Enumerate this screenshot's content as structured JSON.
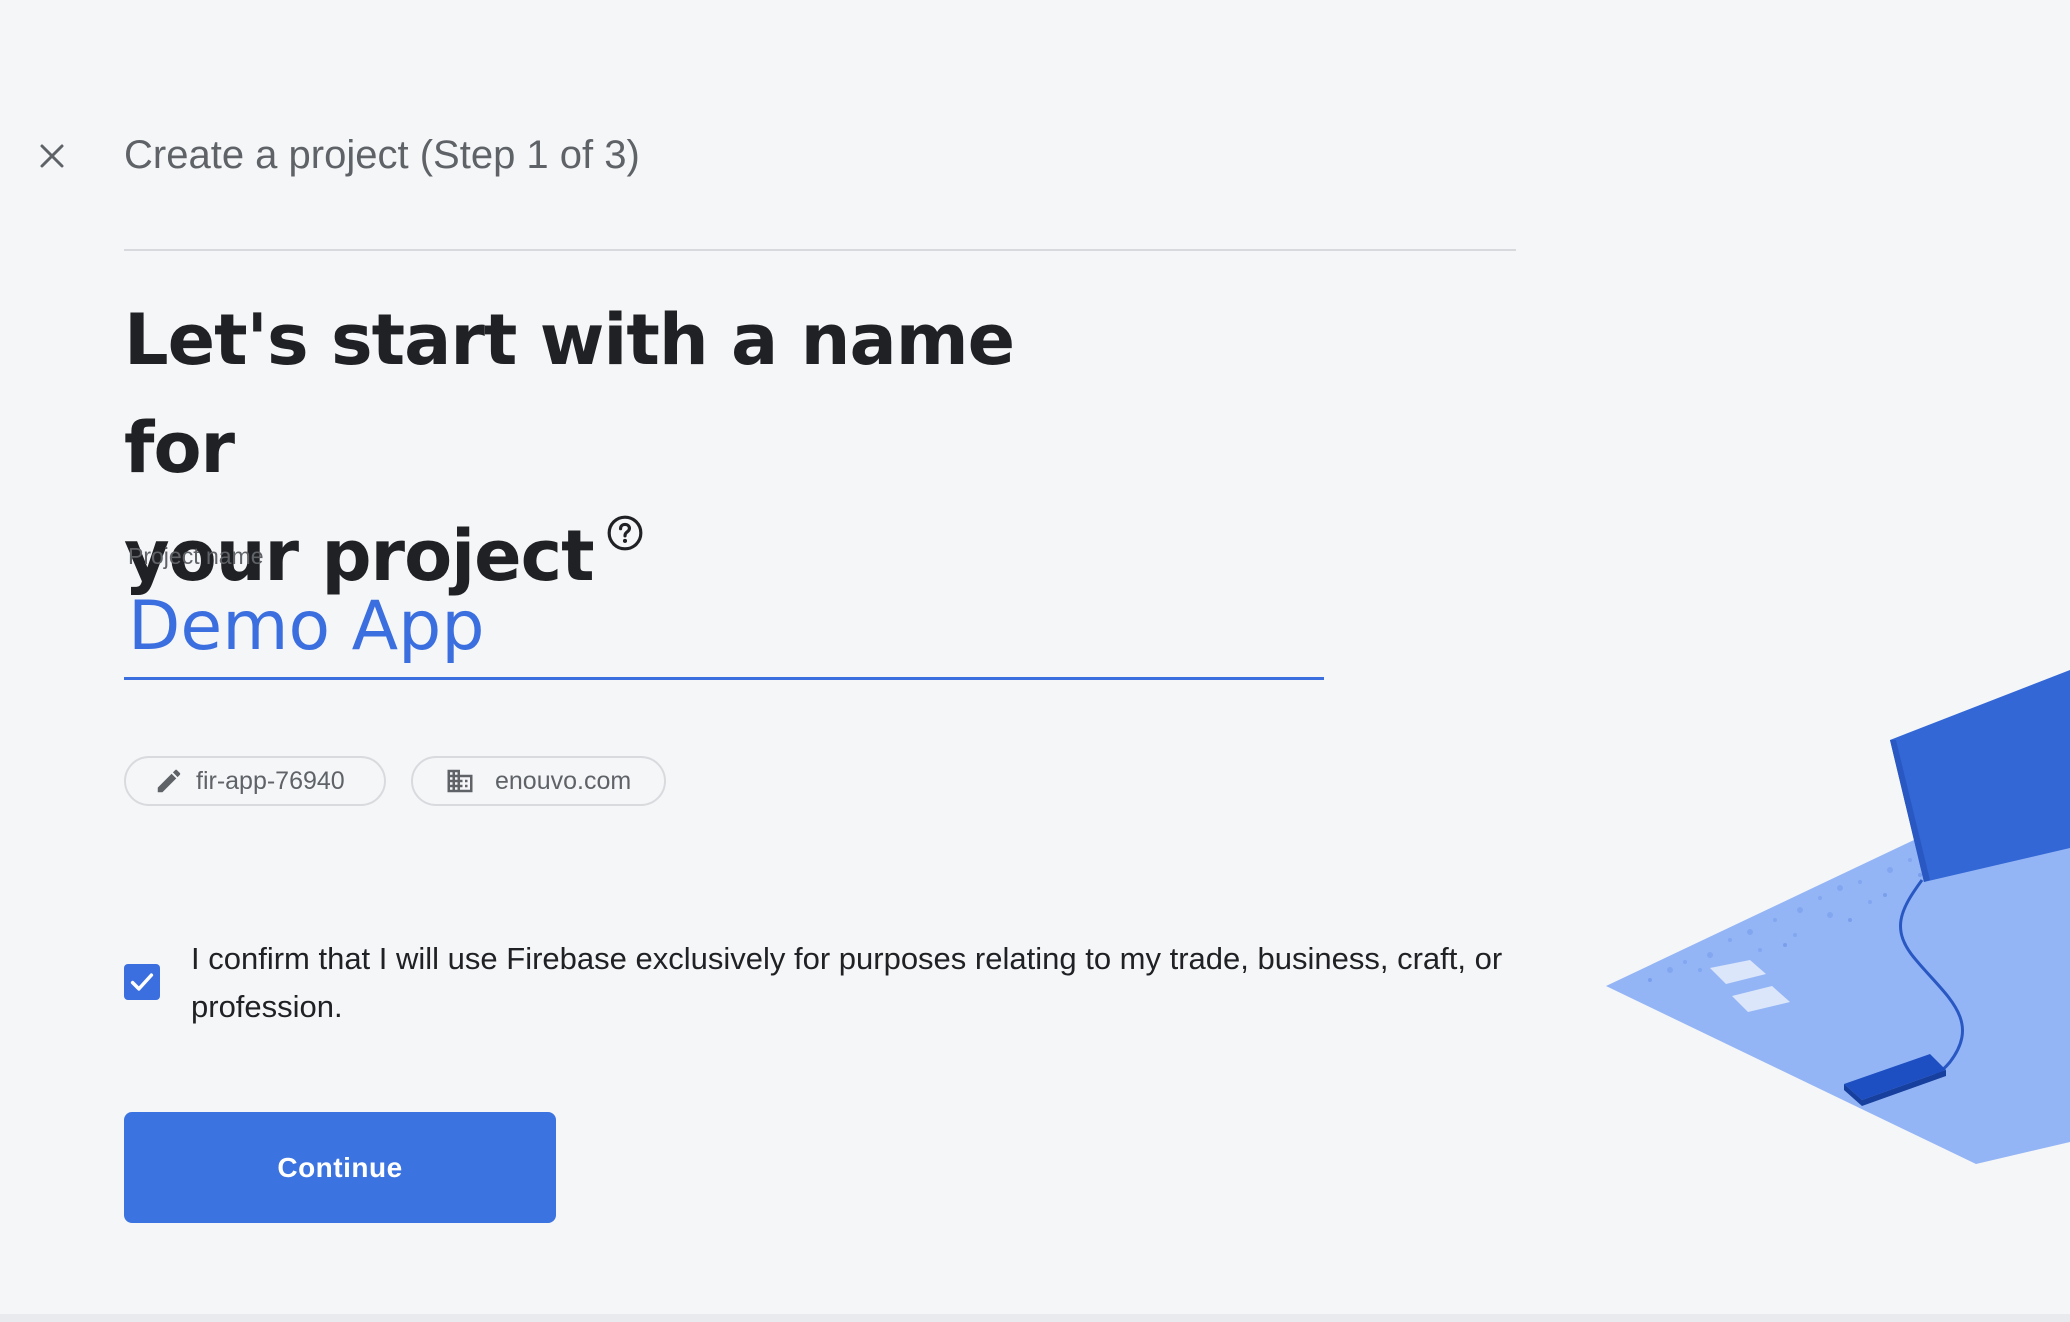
{
  "header": {
    "close_label": "Close",
    "title": "Create a project (Step 1 of 3)"
  },
  "heading": {
    "line1": "Let's start with a name for",
    "line2": "your project"
  },
  "form": {
    "project_name_label": "Project name",
    "project_name_value": "Demo App"
  },
  "chips": {
    "project_id": "fir-app-76940",
    "organization": "enouvo.com"
  },
  "confirmation": {
    "checked": true,
    "text": "I confirm that I will use Firebase exclusively for purposes relating to my trade, business, craft, or profession."
  },
  "actions": {
    "continue_label": "Continue"
  },
  "icons": {
    "close": "close-icon",
    "help": "help-circle-icon",
    "edit": "pencil-icon",
    "organization": "building-icon",
    "checkbox": "check-icon"
  },
  "colors": {
    "accent": "#3b6fdf",
    "background": "#f5f6f8",
    "text": "#202124",
    "secondary_text": "#5f6368"
  }
}
